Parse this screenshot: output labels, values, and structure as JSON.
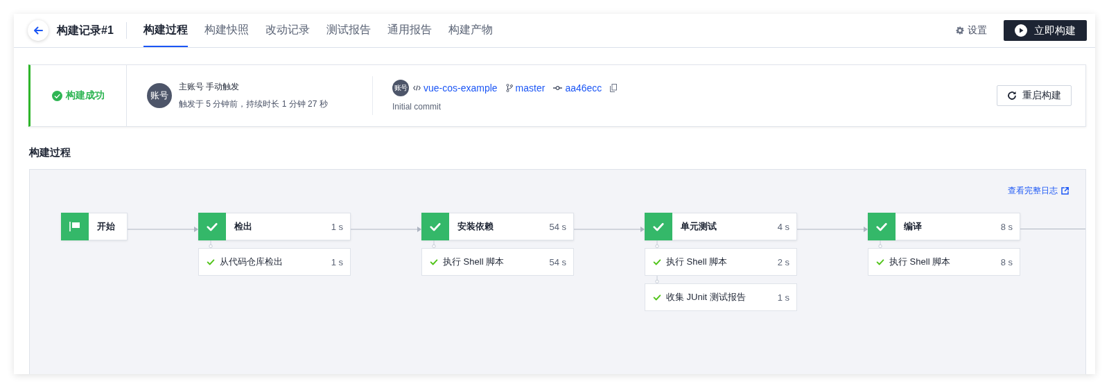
{
  "nav": {
    "title": "构建记录#1",
    "tabs": [
      {
        "label": "构建过程",
        "selected": true
      },
      {
        "label": "构建快照",
        "selected": false
      },
      {
        "label": "改动记录",
        "selected": false
      },
      {
        "label": "测试报告",
        "selected": false
      },
      {
        "label": "通用报告",
        "selected": false
      },
      {
        "label": "构建产物",
        "selected": false
      }
    ],
    "settings": "设置",
    "run_button": "立即构建"
  },
  "summary": {
    "status": "构建成功",
    "avatar": "账号",
    "trigger": "主账号 手动触发",
    "timing": "触发于 5 分钟前，持续时长 1 分钟 27 秒",
    "repo_avatar": "账号",
    "repo": "vue-cos-example",
    "branch": "master",
    "commit": "aa46ecc",
    "message": "Initial commit",
    "restart_button": "重启构建"
  },
  "section_title": "构建过程",
  "log_link": "查看完整日志",
  "stages": [
    {
      "kind": "start",
      "name": "开始"
    },
    {
      "kind": "job",
      "name": "检出",
      "duration": "1 s",
      "steps": [
        {
          "name": "从代码仓库检出",
          "duration": "1 s"
        }
      ]
    },
    {
      "kind": "job",
      "name": "安装依赖",
      "duration": "54 s",
      "steps": [
        {
          "name": "执行 Shell 脚本",
          "duration": "54 s"
        }
      ]
    },
    {
      "kind": "job",
      "name": "单元测试",
      "duration": "4 s",
      "steps": [
        {
          "name": "执行 Shell 脚本",
          "duration": "2 s"
        },
        {
          "name": "收集 JUnit 测试报告",
          "duration": "1 s"
        }
      ]
    },
    {
      "kind": "job",
      "name": "编译",
      "duration": "8 s",
      "steps": [
        {
          "name": "执行 Shell 脚本",
          "duration": "8 s"
        }
      ]
    }
  ]
}
